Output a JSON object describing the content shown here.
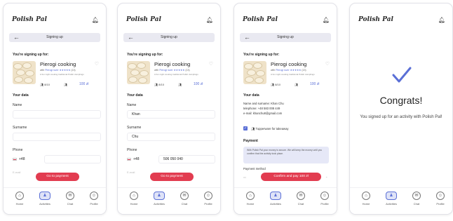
{
  "app": {
    "brand": "Polish Pal"
  },
  "header": {
    "title": "Signing up"
  },
  "signup": {
    "heading": "You're signing up for:",
    "activity": "Pierogi cooking",
    "subtitle_prefix": "with",
    "host": "Pierogi lover",
    "stars": "★★★★★",
    "reviews": "(13)",
    "description": "A fun night cooking traditional Polish dumplings",
    "spots": "8/10",
    "price": "100 zł",
    "your_data": "Your data"
  },
  "form": {
    "name_label": "Name",
    "surname_label": "Surname",
    "phone_label": "Phone",
    "prefix": "+48",
    "email_label": "E-mail",
    "name_value": "Khan",
    "surname_value": "Chu",
    "phone_value": "506 050 040",
    "cta": "Go to payment"
  },
  "summary": {
    "line1": "Name and surname: Khan Chu",
    "line2": "telephone: +48 583 008 449",
    "line3": "e-mail: khanchu8@gmail.com",
    "takeaway": "Tupperware for takeaway",
    "payment_heading": "Payment",
    "info_text": "With Polish Pal your money is secure. We will keep the money until you confirm that the activity took place.",
    "method_label": "Payment method",
    "confirm": "Confirm and pay 100 zł"
  },
  "done": {
    "title": "Congrats!",
    "message": "You signed up for an activity with Polish Pal!"
  },
  "nav": {
    "home": "Home",
    "activities": "Activities",
    "chat": "Chat",
    "profile": "Profile"
  },
  "colors": {
    "accent": "#5a6fd6",
    "cta": "#e23c50",
    "bar": "#e9e9f1"
  }
}
